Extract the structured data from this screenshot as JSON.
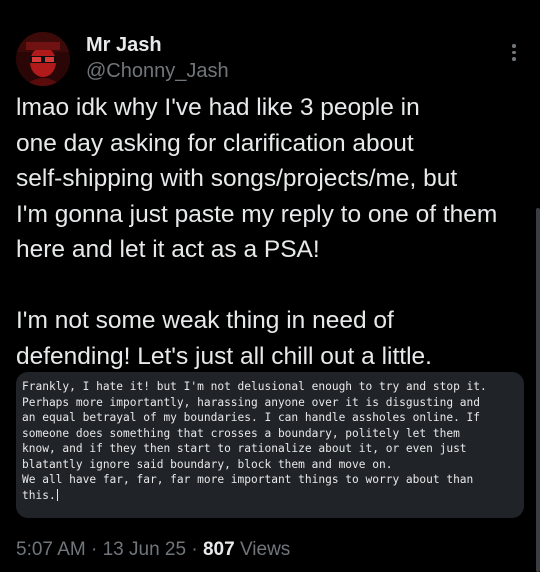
{
  "post": {
    "author": {
      "display_name": "Mr Jash",
      "handle": "@Chonny_Jash",
      "avatar_icon": "avatar-photo"
    },
    "more_icon": "more-vertical-icon",
    "text": "lmao idk why I've had like 3 people in\none day asking for clarification about\nself-shipping with songs/projects/me, but\nI'm gonna just paste my reply to one of them\nhere and let it act as a PSA!\n\nI'm not some weak thing in need of\ndefending! Let's just all chill out a little.",
    "quoted_note": {
      "lines": [
        "Frankly, I hate it! but I'm not delusional enough to try and stop it.",
        "Perhaps more importantly, harassing anyone over it is disgusting and",
        "an equal betrayal of my boundaries. I can handle assholes online. If",
        "someone does something that crosses a boundary, politely let them",
        "know, and if they then start to rationalize about it, or even just",
        "blatantly ignore said boundary, block them and move on.",
        "We all have far, far, far more important things to worry about than",
        "this."
      ]
    },
    "meta": {
      "time": "5:07 AM",
      "separator": "·",
      "date": "13 Jun 25",
      "views_count": "807",
      "views_label": "Views"
    }
  },
  "colors": {
    "background": "#000000",
    "primary_text": "#e7e9ea",
    "secondary_text": "#71767b",
    "quote_background": "#202327"
  }
}
